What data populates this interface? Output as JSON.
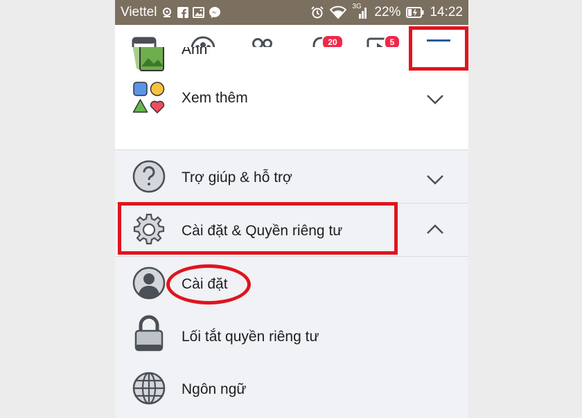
{
  "status_bar": {
    "carrier": "Viettel",
    "network": "3G",
    "battery": "22%",
    "time": "14:22"
  },
  "nav": {
    "notifications_badge": "20",
    "watch_badge": "5"
  },
  "menu": {
    "partial_item": "Ảnh",
    "items": [
      {
        "label": "Xem thêm"
      },
      {
        "label": "Trợ giúp & hỗ trợ"
      },
      {
        "label": "Cài đặt & Quyền riêng tư"
      }
    ],
    "sub_items": [
      {
        "label": "Cài đặt"
      },
      {
        "label": "Lối tắt quyền riêng tư"
      },
      {
        "label": "Ngôn ngữ"
      }
    ]
  },
  "colors": {
    "status_bar": "#7b6f5f",
    "highlight": "#e0141e",
    "icon_blue": "#1c5b9e",
    "badge": "#f02849"
  }
}
